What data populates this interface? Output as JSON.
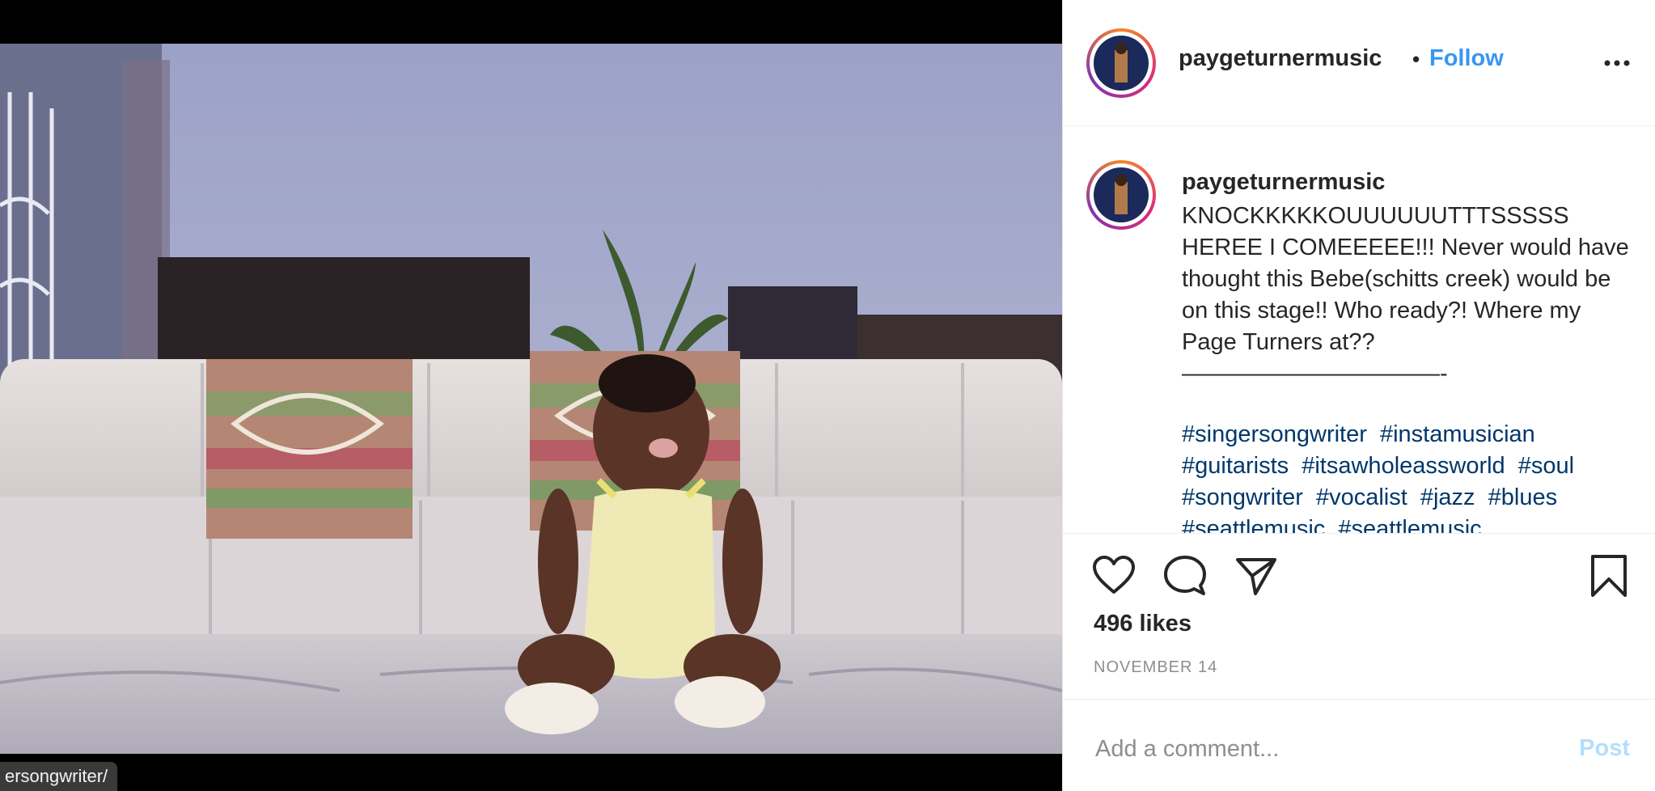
{
  "media": {
    "url_tooltip": "ersongwriter/"
  },
  "post": {
    "username": "paygeturnermusic",
    "follow_label": "Follow",
    "separator": "•",
    "caption_username": "paygeturnermusic",
    "caption_text": "KNOCKKKKKOUUUUUUTTTSSSSS HEREE I COMEEEEE!!! Never would have thought this Bebe(schitts creek) would be on this stage!! Who ready?! Where my Page Turners at??\n———————————-",
    "hashtags": [
      "#singersongwriter",
      "#instamusician",
      "#guitarists",
      "#itsawholeassworld",
      "#soul",
      "#songwriter",
      "#vocalist",
      "#jazz",
      "#blues",
      "#seattlemusic",
      "#seattlemusic"
    ],
    "likes": "496 likes",
    "date": "NOVEMBER 14",
    "comment_placeholder": "Add a comment...",
    "post_label": "Post"
  },
  "icons": {
    "more": "more-options-icon",
    "like": "heart-icon",
    "comment": "comment-bubble-icon",
    "share": "paper-plane-icon",
    "save": "bookmark-icon"
  },
  "colors": {
    "link_blue": "#3897f0",
    "hashtag": "#00376b",
    "post_disabled": "#b2dffc"
  }
}
